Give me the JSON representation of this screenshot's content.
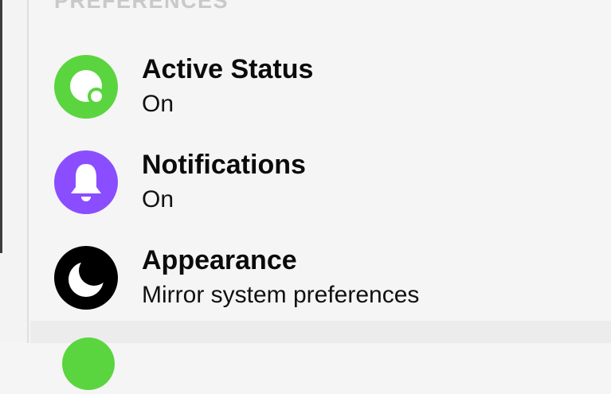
{
  "section": {
    "header": "PREFERENCES"
  },
  "items": [
    {
      "title": "Active Status",
      "value": "On",
      "icon": "active-status-icon",
      "color": "#5ad53f"
    },
    {
      "title": "Notifications",
      "value": "On",
      "icon": "bell-icon",
      "color": "#8a4dff"
    },
    {
      "title": "Appearance",
      "value": "Mirror system preferences",
      "icon": "moon-icon",
      "color": "#000000"
    }
  ],
  "next_item": {
    "icon": "partial-icon",
    "color": "#5ad53f"
  }
}
